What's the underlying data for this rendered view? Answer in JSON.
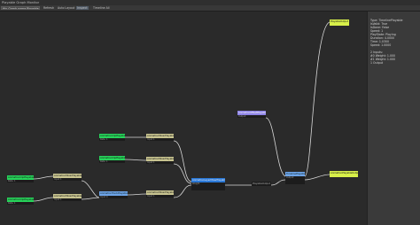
{
  "window": {
    "title": "Playable Graph Monitor"
  },
  "toolbar": {
    "graph_select": "Hip Graph name Playable Director",
    "btn_1": "Refresh",
    "btn_2": "Auto Layout",
    "btn_3": "Inspect",
    "btn_4": "Timeline All"
  },
  "nodes": {
    "clip1": {
      "title": "AnimationClipPlayable",
      "body": "Rate: 1"
    },
    "clip2": {
      "title": "AnimationClipPlayable",
      "body": "Rate: 1"
    },
    "clip3": {
      "title": "AnimationClipPlayable",
      "body": "Rate: 1"
    },
    "clip4": {
      "title": "AnimationClipPlayable",
      "body": "Rate: 1"
    },
    "mix1": {
      "title": "AnimationMixerPlayable",
      "body": "Input 1"
    },
    "mix2": {
      "title": "AnimationMixerPlayable",
      "body": "Input 1"
    },
    "mix3": {
      "title": "AnimationMixerPlayable",
      "body": "Input 1"
    },
    "mix4": {
      "title": "AnimationMixerPlayable",
      "body": "Input 1"
    },
    "track1": {
      "title": "AnimationTrackPlayable",
      "body": "Input 0"
    },
    "layer": {
      "title": "AnimationLayerMixerPlayable",
      "body": "Weight"
    },
    "timeline": {
      "title": "TimelinePlayable",
      "body": "Output"
    },
    "output1": {
      "title": "PlayableOutput",
      "body": ""
    },
    "output2": {
      "title": "AnimationPlayableOutput",
      "body": ""
    },
    "purple": {
      "title": "AnimationOffsetPlayable",
      "body": "Output"
    }
  },
  "inspector": {
    "lines": [
      "Type: TimelinePlayable",
      "IsValid: True",
      "IsDone: False",
      "Speed: 1",
      "PlayState: Playing",
      "Duration: 4.0000",
      "Time: 1.0300",
      "Speed: 1.0000",
      "",
      "2 Inputs:",
      "  #0 Weight: 1.000",
      "  #1 Weight: 1.000",
      "1 Output"
    ]
  }
}
